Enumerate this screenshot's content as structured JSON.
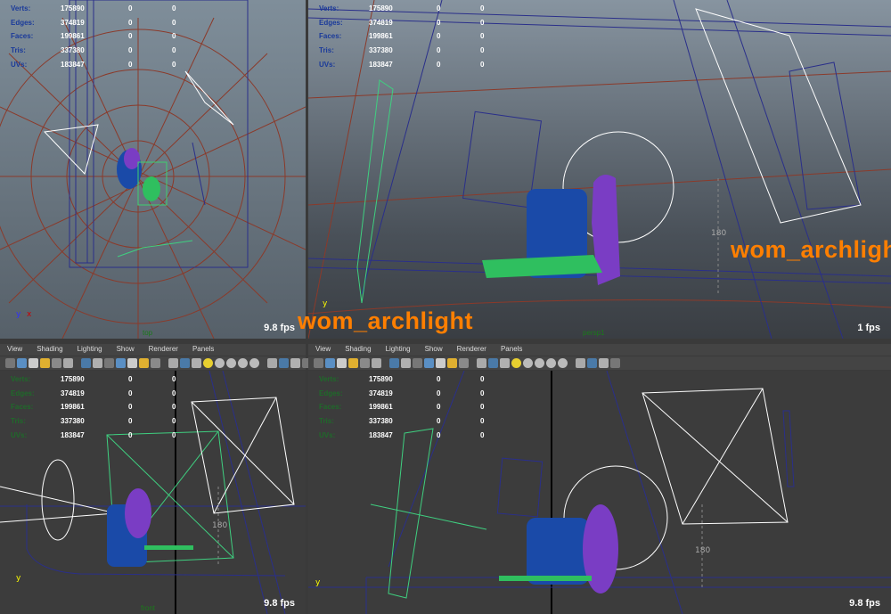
{
  "hud_labels": [
    "Verts:",
    "Edges:",
    "Faces:",
    "Tris:",
    "UVs:"
  ],
  "hud_values": [
    [
      "175890",
      "0",
      "0"
    ],
    [
      "374819",
      "0",
      "0"
    ],
    [
      "199861",
      "0",
      "0"
    ],
    [
      "337380",
      "0",
      "0"
    ],
    [
      "183847",
      "0",
      "0"
    ]
  ],
  "panel_menu": [
    "View",
    "Shading",
    "Lighting",
    "Show",
    "Renderer",
    "Panels"
  ],
  "viewports": [
    {
      "camera": "top",
      "fps": "9.8 fps",
      "hud_label_color": "#1a3a9a"
    },
    {
      "camera": "persp1",
      "fps": "1 fps",
      "hud_label_color": "#1a3a9a",
      "light_label": "wom_archlight",
      "dimension": "180"
    },
    {
      "camera": "front",
      "fps": "9.8 fps",
      "hud_label_color": "#1f6a2a",
      "dimension": "180"
    },
    {
      "camera": "",
      "fps": "9.8 fps",
      "hud_label_color": "#1f6a2a",
      "dimension": "180"
    }
  ],
  "colors": {
    "light_label": "#ff7f00",
    "hud_value": "#ffffff",
    "wireframe_grid": "#8b3a2a",
    "wireframe_blue": "#2a2f8a",
    "wireframe_green": "#3fd080",
    "light_wire": "#ffffff",
    "figure_purple": "#7a3dc4",
    "chair_blue": "#1a4aa8"
  },
  "toolbar_icons": [
    "camera-select-icon",
    "camera-attributes-icon",
    "bookmark-icon",
    "image-plane-icon",
    "2d-pan-zoom-icon",
    "grease-pencil-icon",
    "grid-icon",
    "film-gate-icon",
    "resolution-gate-icon",
    "gate-mask-icon",
    "field-chart-icon",
    "safe-action-icon",
    "safe-title-icon",
    "wireframe-icon",
    "smooth-shade-icon",
    "textured-icon",
    "use-lights-icon",
    "shadows-icon",
    "screen-space-ao-icon",
    "motion-blur-icon",
    "anti-alias-icon",
    "isolate-select-icon",
    "xray-icon",
    "xray-joints-icon",
    "xray-components-icon"
  ]
}
